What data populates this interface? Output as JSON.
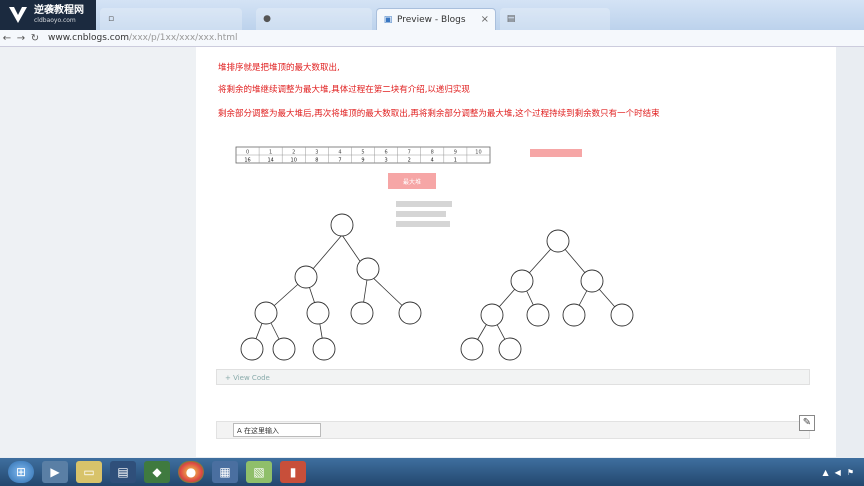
{
  "watermark": {
    "line1": "逆袭教程网",
    "line2": "cldbaoyo.com"
  },
  "tabs": [
    {
      "label": "",
      "active": false,
      "icon": "blank-page-icon"
    },
    {
      "label": "",
      "active": false,
      "icon": "github-icon"
    },
    {
      "label": "Preview - Blogs",
      "active": true,
      "icon": "blog-icon"
    },
    {
      "label": "",
      "active": false,
      "icon": "page-icon"
    }
  ],
  "address": {
    "domain": "www.cnblogs.com",
    "path": "/xxx/p/1xx/xxx/xxx.html"
  },
  "content": {
    "line1": "堆排序就是把堆顶的最大数取出,",
    "line2": "将剩余的堆继续调整为最大堆,具体过程在第二块有介绍,以递归实现",
    "line3": "剩余部分调整为最大堆后,再次将堆顶的最大数取出,再将剩余部分调整为最大堆,这个过程持续到剩余数只有一个时结束",
    "array_header": [
      "0",
      "1",
      "2",
      "3",
      "4",
      "5",
      "6",
      "7",
      "8",
      "9",
      "10"
    ],
    "array_values": [
      "16",
      "14",
      "10",
      "8",
      "7",
      "9",
      "3",
      "2",
      "4",
      "1",
      ""
    ],
    "note_pink": "最大堆",
    "note_gray": [
      "",
      "",
      ""
    ],
    "right_note": "",
    "code_hint": "+ View Code",
    "input_label": "A 在这里输入"
  },
  "colors": {
    "accent_red": "#e01e1e",
    "taskbar": "#2c5783"
  }
}
